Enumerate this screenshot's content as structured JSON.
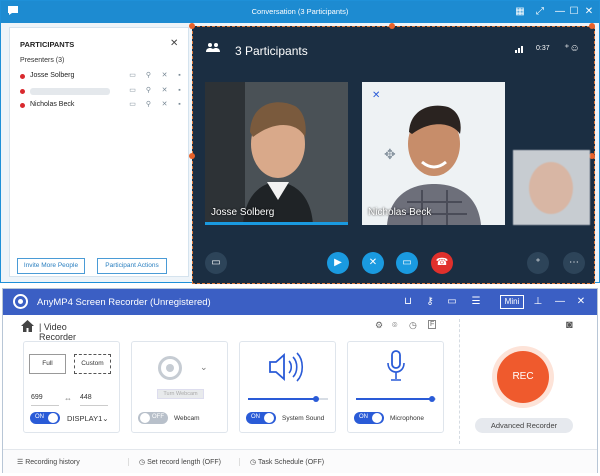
{
  "skype": {
    "title": "Conversation (3 Participants)",
    "participants_header": "PARTICIPANTS",
    "presenters_label": "Presenters (3)",
    "participants": [
      {
        "name": "Josse Solberg"
      },
      {
        "name": ""
      },
      {
        "name": "Nicholas Beck"
      }
    ],
    "invite_button": "Invite More People",
    "actions_button": "Participant Actions",
    "participants_count": "3 Participants",
    "call_time": "0:37",
    "tiles": [
      {
        "caption": "Josse Solberg"
      },
      {
        "caption": "Nicholas Beck"
      }
    ]
  },
  "recorder": {
    "title": "AnyMP4 Screen Recorder (Unregistered)",
    "mini_label": "Mini",
    "mode_label": "| Video Recorder",
    "area": {
      "full_label": "Full",
      "custom_label": "Custom",
      "width": "699",
      "height": "448",
      "toggle": "ON",
      "display": "DISPLAY1"
    },
    "webcam": {
      "toggle": "OFF",
      "label": "Webcam",
      "turn_on": "Turn Webcam"
    },
    "system_sound": {
      "toggle": "ON",
      "label": "System Sound",
      "level": 0.85
    },
    "microphone": {
      "toggle": "ON",
      "label": "Microphone",
      "level": 0.95
    },
    "rec_label": "REC",
    "advanced_label": "Advanced Recorder",
    "footer": {
      "history": "Recording history",
      "length": "Set record length (OFF)",
      "schedule": "Task Schedule (OFF)"
    }
  },
  "colors": {
    "skype_blue": "#1d8bd1",
    "recorder_blue": "#3b5fc4",
    "rec_orange": "#ef5a2d",
    "presence_red": "#d9292e"
  }
}
